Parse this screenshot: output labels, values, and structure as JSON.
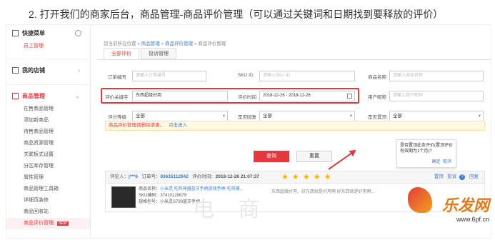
{
  "caption": "2. 打开我们的商家后台，商品管理-商品评价管理（可以通过关键词和日期找到要释放的评价）",
  "sidebar": {
    "quick_menu": "快捷菜单",
    "staff": "员工管理",
    "my_shop": "我的店铺",
    "goods_manage": "商品管理",
    "items": [
      "在售商品管理",
      "添加新商品",
      "待售商品管理",
      "商品资源管理",
      "关联板式设置",
      "分区库存管理",
      "属性管理",
      "商品管理工具箱",
      "详细页装修",
      "商品回收站",
      "商品评价管理"
    ],
    "new_badge": "NEW"
  },
  "breadcrumb": {
    "prefix": "您当前所在位置 »",
    "l1": "商品管理",
    "sep": " » ",
    "l2": "商品评价管理",
    "l3": "商品评价管理"
  },
  "tabs": [
    "全部评价",
    "投诉管理"
  ],
  "filters": {
    "order_label": "订单编号",
    "order_ph": "请输入订单编号",
    "sku_label": "SKU ID",
    "sku_ph": "请输入SKU ID",
    "goods_label": "商品名称",
    "goods_ph": "请输入商品名称",
    "keyword_label": "评价关键字",
    "keyword_value": "东西超级好用",
    "time_label": "评价时间",
    "time_value": "2018-12-26 - 2018-12-26",
    "user_label": "用户昵称",
    "user_ph": "请输入用户昵称",
    "level_label": "评分等级",
    "level_value": "全部",
    "reply_label": "是否回复",
    "reply_value": "全部",
    "top_label": "是否置顶",
    "top_value": "全部"
  },
  "notice": {
    "text": "商品评价管理请删除请查。",
    "link": "点击进入"
  },
  "buttons": {
    "search": "查询",
    "reset": "重置"
  },
  "popup": {
    "text": "是否置顶此条评价(置顶评价有效期为1个月)?",
    "ok": "确定",
    "cancel": "取消"
  },
  "review": {
    "reviewer_label": "评论人：",
    "reviewer": "j***6",
    "order_label": "订单号：",
    "order_no": "83635112942",
    "time_label": "评价时间：",
    "time": "2018-12-26 21:07:37",
    "stars": "★ ★ ★ ★ ★",
    "rating": 5,
    "action_top": "置顶",
    "action_report": "投诉",
    "action_reply": "回复",
    "product_label": "商品名称：",
    "product": "小米灵 吃鸡神器蓝牙手柄游戏手柄 吃鸡辅...",
    "sku_label": "SKU编码：",
    "sku": "37410129679",
    "spec_label": "规格型号：",
    "spec": "小米灵S730蓝牙手柄",
    "comment": "东西超级好用，好东西就是好用啊 好东西就是好用啊..."
  },
  "watermark": "电 商",
  "logo": {
    "name": "乐发网",
    "url": "www.6pf.cn"
  }
}
